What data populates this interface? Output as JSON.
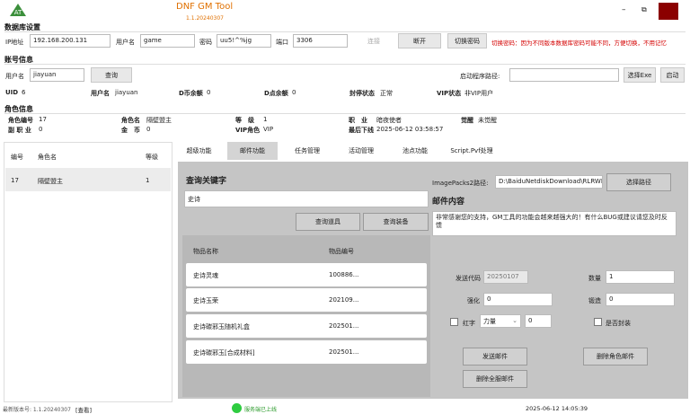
{
  "app": {
    "title": "DNF GM Tool",
    "version": "1.1.20240307",
    "window_controls": {
      "minimize": "–",
      "restore": "⧉"
    }
  },
  "db": {
    "section": "数据库设置",
    "ip_label": "IP地址",
    "ip": "192.168.200.131",
    "user_label": "用户名",
    "user": "game",
    "pwd_label": "密码",
    "pwd": "uu5!^%jg",
    "port_label": "端口",
    "port": "3306",
    "connect": "连接",
    "reconnect": "断开",
    "switch_pwd": "切换密码",
    "switch_hint": "切换密码：因为不同版本数据库密码可能不同，方便切换，不用记忆"
  },
  "account": {
    "section": "账号信息",
    "user_label": "用户名",
    "user": "jiayuan",
    "query": "查询",
    "launcher_label": "启动程序路径:",
    "choose_exe": "选择Exe",
    "start": "启动",
    "uid_label": "UID",
    "uid": "6",
    "uname_label": "用户名",
    "uname": "jiayuan",
    "dcoin_label": "D币余额",
    "dcoin": "0",
    "dpoint_label": "D点余额",
    "dpoint": "0",
    "ban_label": "封停状态",
    "ban": "正常",
    "vip_label": "VIP状态",
    "vip": "非VIP用户"
  },
  "role": {
    "section": "角色信息",
    "id_label": "角色编号",
    "id": "17",
    "name_label": "角色名",
    "name": "隔壁盟主",
    "level_label": "等　级",
    "level": "1",
    "job_label": "职　业",
    "job": "暗夜使者",
    "awaken_label": "觉醒",
    "awaken": "未觉醒",
    "subjob_label": "副 职 业",
    "subjob": "0",
    "gold_label": "金　币",
    "gold": "0",
    "viprole_label": "VIP角色",
    "viprole": "VIP",
    "last_label": "最后下线",
    "last": "2025-06-12 03:58:57"
  },
  "role_table": {
    "headers": [
      "编号",
      "角色名",
      "等级"
    ],
    "rows": [
      {
        "id": "17",
        "name": "隔壁盟主",
        "level": "1"
      }
    ]
  },
  "tabs": [
    "超级功能",
    "邮件功能",
    "任务管理",
    "活动管理",
    "池点功能",
    "Script.Pvf处理"
  ],
  "mail": {
    "query_title": "查询关键字",
    "keyword": "史诗",
    "query_item": "查询道具",
    "query_equip": "查询装备",
    "col_name": "物品名称",
    "col_code": "物品编号",
    "items": [
      {
        "name": "史诗灵魂",
        "code": "100886..."
      },
      {
        "name": "史诗玉荣",
        "code": "202109..."
      },
      {
        "name": "史诗碳邪玉随机礼盒",
        "code": "202501..."
      },
      {
        "name": "史诗碳邪玉[合成材料]",
        "code": "202501..."
      }
    ],
    "imagepacks_label": "ImagePacks2路径:",
    "imagepacks": "D:\\BaiduNetdiskDownload\\RLRWL",
    "choose_path": "选择路径",
    "content_title": "邮件内容",
    "content": "非常感谢您的支持，GM工具的功能会越来越强大的！有什么BUG或建议请您及时反馈",
    "send_code_label": "发送代码",
    "send_code": "20250107",
    "count_label": "数量",
    "count": "1",
    "enhance_label": "强化",
    "enhance": "0",
    "forge_label": "锻造",
    "forge": "0",
    "red_label": "红字",
    "red_attr": "力量",
    "red_value": "0",
    "seal_label": "是否封装",
    "send": "发送邮件",
    "delete_role_mail": "删除角色邮件",
    "delete_all_mail": "删除全服邮件"
  },
  "status": {
    "version": "最新版本号: 1.1.20240307",
    "view": "[查看]",
    "server": "服务端已上线",
    "time": "2025-06-12 14:05:39"
  },
  "colors": {
    "accent": "#e07000",
    "close": "#8b0000",
    "warn": "#d40000",
    "status_ok": "#2ecc40"
  }
}
